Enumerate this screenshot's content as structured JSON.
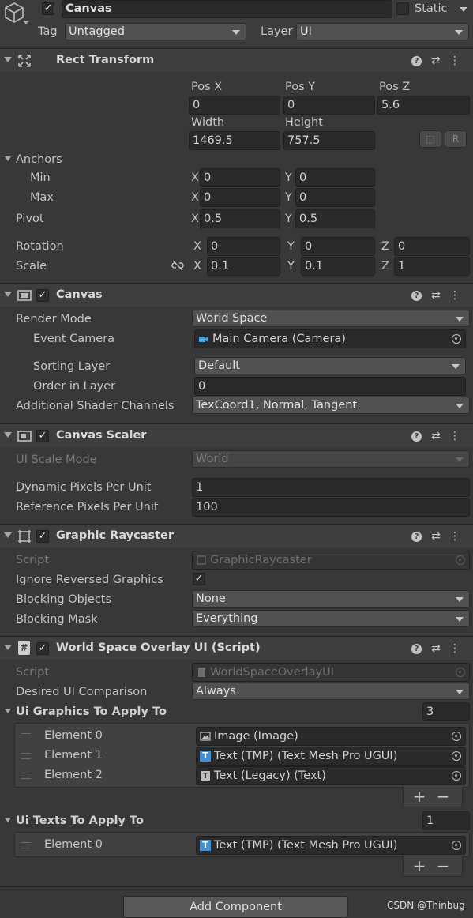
{
  "gameobject": {
    "active": true,
    "name": "Canvas",
    "static_label": "Static",
    "static_checked": false,
    "tag_label": "Tag",
    "tag_value": "Untagged",
    "layer_label": "Layer",
    "layer_value": "UI"
  },
  "rect_transform": {
    "title": "Rect Transform",
    "pos_x_label": "Pos X",
    "pos_x": "0",
    "pos_y_label": "Pos Y",
    "pos_y": "0",
    "pos_z_label": "Pos Z",
    "pos_z": "5.6",
    "width_label": "Width",
    "width": "1469.5",
    "height_label": "Height",
    "height": "757.5",
    "r_button": "R",
    "anchors_label": "Anchors",
    "min_label": "Min",
    "min_x": "0",
    "min_y": "0",
    "max_label": "Max",
    "max_x": "0",
    "max_y": "0",
    "pivot_label": "Pivot",
    "pivot_x": "0.5",
    "pivot_y": "0.5",
    "rotation_label": "Rotation",
    "rot_x": "0",
    "rot_y": "0",
    "rot_z": "0",
    "scale_label": "Scale",
    "scale_x": "0.1",
    "scale_y": "0.1",
    "scale_z": "1",
    "axis_x": "X",
    "axis_y": "Y",
    "axis_z": "Z"
  },
  "canvas": {
    "title": "Canvas",
    "enabled": true,
    "render_mode_label": "Render Mode",
    "render_mode": "World Space",
    "event_camera_label": "Event Camera",
    "event_camera": "Main Camera (Camera)",
    "sorting_layer_label": "Sorting Layer",
    "sorting_layer": "Default",
    "order_in_layer_label": "Order in Layer",
    "order_in_layer": "0",
    "shader_channels_label": "Additional Shader Channels",
    "shader_channels": "TexCoord1, Normal, Tangent"
  },
  "canvas_scaler": {
    "title": "Canvas Scaler",
    "enabled": true,
    "ui_scale_mode_label": "UI Scale Mode",
    "ui_scale_mode": "World",
    "dynamic_ppu_label": "Dynamic Pixels Per Unit",
    "dynamic_ppu": "1",
    "reference_ppu_label": "Reference Pixels Per Unit",
    "reference_ppu": "100"
  },
  "graphic_raycaster": {
    "title": "Graphic Raycaster",
    "enabled": true,
    "script_label": "Script",
    "script": "GraphicRaycaster",
    "ignore_reversed_label": "Ignore Reversed Graphics",
    "ignore_reversed": true,
    "blocking_objects_label": "Blocking Objects",
    "blocking_objects": "None",
    "blocking_mask_label": "Blocking Mask",
    "blocking_mask": "Everything"
  },
  "overlay_script": {
    "title": "World Space Overlay UI (Script)",
    "enabled": true,
    "script_label": "Script",
    "script": "WorldSpaceOverlayUI",
    "desired_comparison_label": "Desired UI Comparison",
    "desired_comparison": "Always",
    "graphics_list_label": "Ui Graphics To Apply To",
    "graphics_count": "3",
    "graphics": [
      {
        "label": "Element 0",
        "value": "Image (Image)",
        "icon": "image-icon"
      },
      {
        "label": "Element 1",
        "value": "Text (TMP) (Text Mesh Pro UGUI)",
        "icon": "tmp-text-icon"
      },
      {
        "label": "Element 2",
        "value": "Text (Legacy) (Text)",
        "icon": "legacy-text-icon"
      }
    ],
    "texts_list_label": "Ui Texts To Apply To",
    "texts_count": "1",
    "texts": [
      {
        "label": "Element 0",
        "value": "Text (TMP) (Text Mesh Pro UGUI)",
        "icon": "tmp-text-icon"
      }
    ],
    "plus": "+",
    "minus": "−"
  },
  "footer": {
    "add_component": "Add Component",
    "watermark": "CSDN @Thinbug"
  },
  "colors": {
    "background": "#383838",
    "header": "#3e3e3e",
    "field": "#2a2a2a",
    "dropdown": "#515151",
    "tmp_blue": "#3d8fd6",
    "camera_blue": "#4aa3df"
  }
}
